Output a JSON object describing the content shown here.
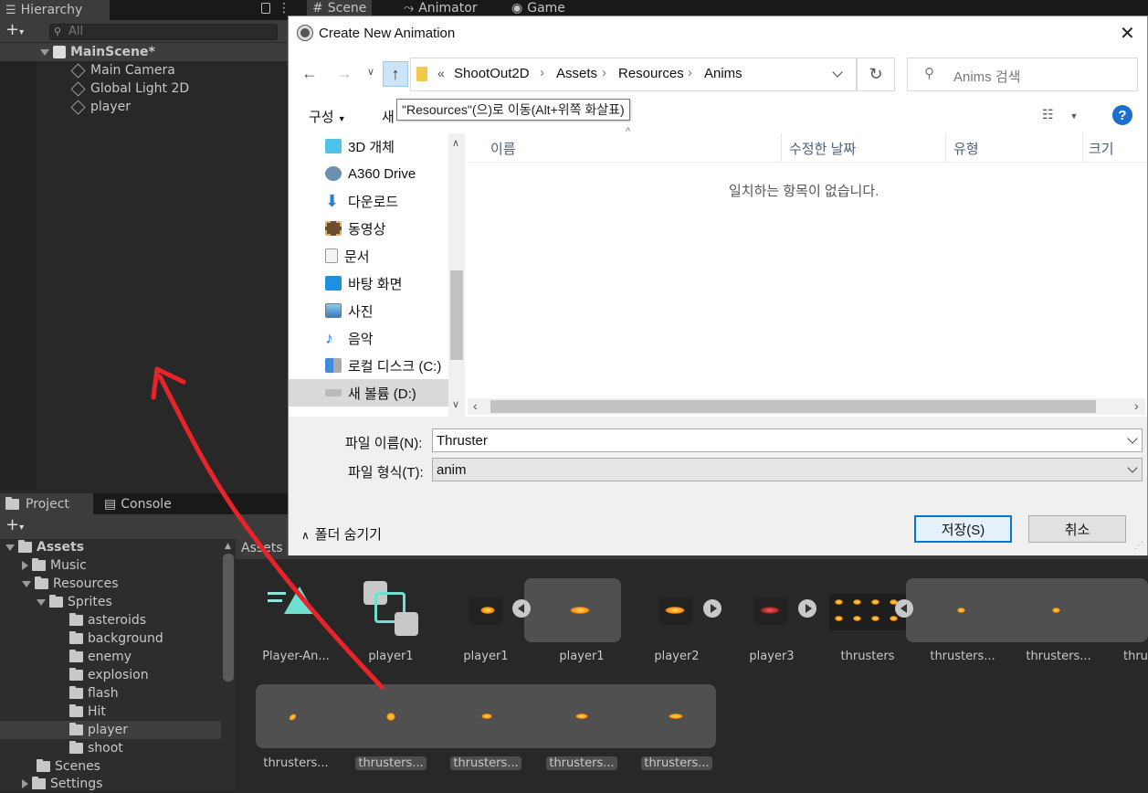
{
  "unity": {
    "hierarchy": {
      "tab": "Hierarchy",
      "search_placeholder": "All",
      "scene": "MainScene*",
      "objects": [
        "Main Camera",
        "Global Light 2D",
        "player"
      ]
    },
    "top_tabs": [
      "Scene",
      "Animator",
      "Game"
    ],
    "project": {
      "tabs": [
        "Project",
        "Console"
      ],
      "breadcrumb": "Assets",
      "tree": {
        "assets": "Assets",
        "music": "Music",
        "resources": "Resources",
        "sprites": "Sprites",
        "sprite_folders": [
          "asteroids",
          "background",
          "enemy",
          "explosion",
          "flash",
          "Hit",
          "player",
          "shoot"
        ],
        "scenes": "Scenes",
        "settings": "Settings"
      },
      "assets_row1": [
        "Player-An...",
        "player1",
        "player1",
        "player1",
        "player2",
        "player3",
        "thrusters",
        "thrusters...",
        "thrusters...",
        "thrus"
      ],
      "assets_row2": [
        "thrusters...",
        "thrusters...",
        "thrusters...",
        "thrusters...",
        "thrusters..."
      ]
    }
  },
  "dialog": {
    "title": "Create New Animation",
    "breadcrumb": [
      "ShootOut2D",
      "Assets",
      "Resources",
      "Anims"
    ],
    "breadcrumb_overflow": "«",
    "search_placeholder": "Anims 검색",
    "organize": "구성",
    "new_folder_partial": "새",
    "tooltip": "\"Resources\"(으)로 이동(Alt+위쪽 화살표)",
    "nav_items": [
      "3D 개체",
      "A360 Drive",
      "다운로드",
      "동영상",
      "문서",
      "바탕 화면",
      "사진",
      "음악",
      "로컬 디스크 (C:)",
      "새 볼륨 (D:)"
    ],
    "columns": [
      "이름",
      "수정한 날짜",
      "유형",
      "크기"
    ],
    "empty_message": "일치하는 항목이 없습니다.",
    "filename_label": "파일 이름(N):",
    "filename_value": "Thruster",
    "filetype_label": "파일 형식(T):",
    "filetype_value": "anim",
    "hide_folders": "폴더 숨기기",
    "save": "저장(S)",
    "cancel": "취소",
    "help": "?"
  },
  "colors": {
    "annotation_arrow": "#e8232a",
    "accent": "#0078d7",
    "help": "#1a6fcf"
  }
}
